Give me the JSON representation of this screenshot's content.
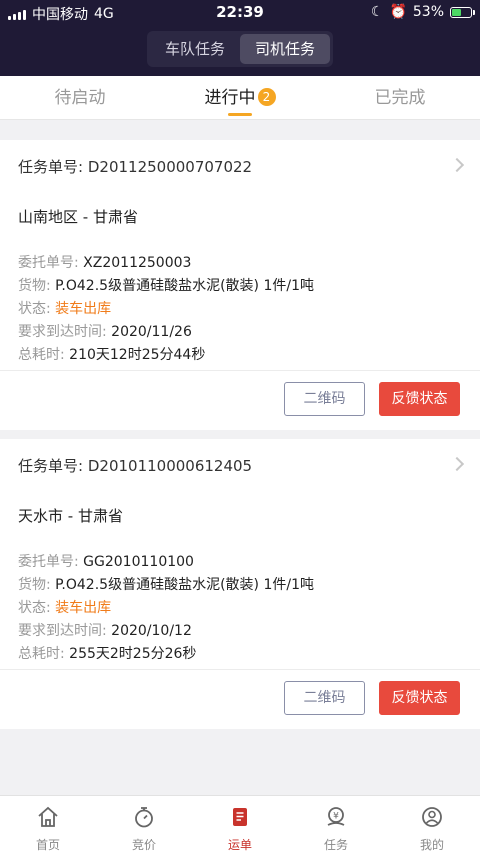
{
  "status_bar": {
    "carrier": "中国移动",
    "network": "4G",
    "time": "22:39",
    "battery": "53%",
    "battery_level": 0.53
  },
  "segment": {
    "items": [
      "车队任务",
      "司机任务"
    ],
    "active": 1
  },
  "tabs": [
    {
      "label": "待启动"
    },
    {
      "label": "进行中",
      "badge": "2"
    },
    {
      "label": "已完成"
    }
  ],
  "tasks": [
    {
      "order_label": "任务单号:",
      "order_no": "D2011250000707022",
      "region": "山南地区 - 甘肃省",
      "consign_label": "委托单号:",
      "consign_no": "XZ2011250003",
      "goods_label": "货物:",
      "goods": "P.O42.5级普通硅酸盐水泥(散装) 1件/1吨",
      "status_label": "状态:",
      "status": "装车出库",
      "arrive_label": "要求到达时间:",
      "arrive": "2020/11/26",
      "time_label": "总耗时:",
      "duration": "210天12时25分44秒",
      "qr_btn": "二维码",
      "feedback_btn": "反馈状态"
    },
    {
      "order_label": "任务单号:",
      "order_no": "D2010110000612405",
      "region": "天水市 - 甘肃省",
      "consign_label": "委托单号:",
      "consign_no": "GG2010110100",
      "goods_label": "货物:",
      "goods": "P.O42.5级普通硅酸盐水泥(散装) 1件/1吨",
      "status_label": "状态:",
      "status": "装车出库",
      "arrive_label": "要求到达时间:",
      "arrive": "2020/10/12",
      "time_label": "总耗时:",
      "duration": "255天2时25分26秒",
      "qr_btn": "二维码",
      "feedback_btn": "反馈状态"
    }
  ],
  "bottom_nav": [
    {
      "label": "首页",
      "icon": "home-icon"
    },
    {
      "label": "竞价",
      "icon": "stopwatch-icon"
    },
    {
      "label": "运单",
      "icon": "waybill-icon",
      "active": true
    },
    {
      "label": "任务",
      "icon": "task-icon"
    },
    {
      "label": "我的",
      "icon": "profile-icon"
    }
  ],
  "colors": {
    "header_bg": "#1f1a36",
    "accent_orange": "#f5a623",
    "status_orange": "#f07c1b",
    "feedback_red": "#e84a3d",
    "nav_active_red": "#c8332c"
  }
}
